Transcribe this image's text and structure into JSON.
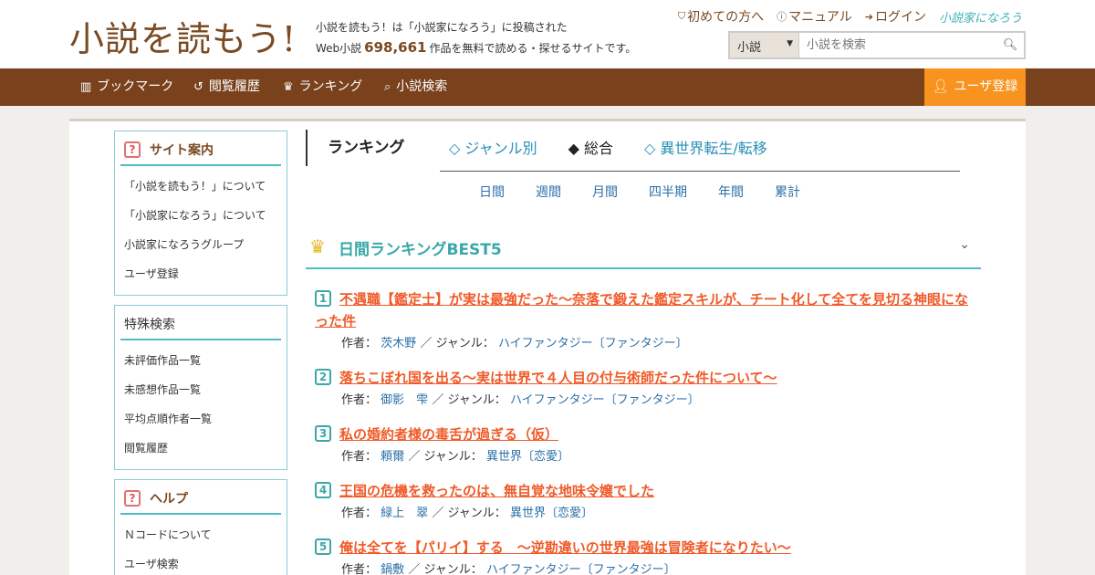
{
  "header": {
    "logo": "小説を読もう!",
    "tagline_line1": "小説を読もう！は「小説家になろう」に投稿された",
    "tagline_pre": "Web小説",
    "tagline_count": "698,661",
    "tagline_post": "作品を無料で読める・探せるサイトです。",
    "links": [
      "初めての方へ",
      "マニュアル",
      "ログイン"
    ],
    "brand": "小説家になろう",
    "search_select": "小説",
    "search_placeholder": "小説を検索"
  },
  "nav": {
    "items": [
      "ブックマーク",
      "閲覧履歴",
      "ランキング",
      "小説検索"
    ],
    "register": "ユーザ登録"
  },
  "sidebar": {
    "site_guide": {
      "title": "サイト案内",
      "items": [
        "「小説を読もう！」について",
        "「小説家になろう」について",
        "小説家になろうグループ",
        "ユーザ登録"
      ]
    },
    "special_search": {
      "title": "特殊検索",
      "items": [
        "未評価作品一覧",
        "未感想作品一覧",
        "平均点順作者一覧",
        "閲覧履歴"
      ]
    },
    "help": {
      "title": "ヘルプ",
      "items": [
        "Ｎコードについて",
        "ユーザ検索"
      ]
    }
  },
  "ranking": {
    "heading": "ランキング",
    "tabs": [
      "◇ ジャンル別",
      "◆ 総合",
      "◇ 異世界転生/転移"
    ],
    "periods": [
      "日間",
      "週間",
      "月間",
      "四半期",
      "年間",
      "累計"
    ],
    "best_title": "日間ランキングBEST5",
    "author_label": "作者：",
    "genre_label": "／ ジャンル：",
    "entries": [
      {
        "rank": "1",
        "title": "不遇職【鑑定士】が実は最強だった〜奈落で鍛えた鑑定スキルが、チート化して全てを見切る神眼になった件",
        "author": "茨木野",
        "genre": "ハイファンタジー〔ファンタジー〕"
      },
      {
        "rank": "2",
        "title": "落ちこぼれ国を出る〜実は世界で４人目の付与術師だった件について〜",
        "author": "御影　雫",
        "genre": "ハイファンタジー〔ファンタジー〕"
      },
      {
        "rank": "3",
        "title": "私の婚約者様の毒舌が過ぎる（仮）",
        "author": "頼爾",
        "genre": "異世界〔恋愛〕"
      },
      {
        "rank": "4",
        "title": "王国の危機を救ったのは、無自覚な地味令嬢でした",
        "author": "緑上　翠",
        "genre": "異世界〔恋愛〕"
      },
      {
        "rank": "5",
        "title": "俺は全てを【パリイ】する　〜逆勘違いの世界最強は冒険者になりたい〜",
        "author": "鍋敷",
        "genre": "ハイファンタジー〔ファンタジー〕"
      }
    ]
  }
}
